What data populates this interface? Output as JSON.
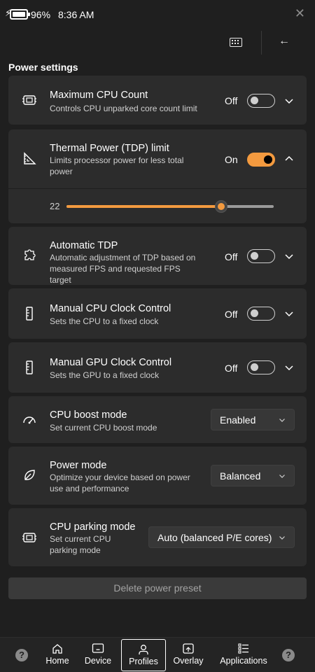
{
  "status_bar": {
    "battery_percent": "96%",
    "time": "8:36 AM",
    "close_label": "✕"
  },
  "header": {
    "back_label": "←"
  },
  "section_title": "Power settings",
  "settings": [
    {
      "title": "Maximum CPU Count",
      "desc": "Controls CPU unparked core count limit",
      "state": "Off",
      "on": false,
      "icon": "cpu-chip-icon"
    },
    {
      "title": "Thermal Power (TDP) limit",
      "desc": "Limits processor power for less total power",
      "state": "On",
      "on": true,
      "icon": "ruler-triangle-icon"
    },
    {
      "title": "Automatic TDP",
      "desc": "Automatic adjustment of TDP based on measured FPS and requested FPS target",
      "state": "Off",
      "on": false,
      "icon": "puzzle-icon"
    },
    {
      "title": "Manual CPU Clock Control",
      "desc": "Sets the CPU to a fixed clock",
      "state": "Off",
      "on": false,
      "icon": "ruler-icon"
    },
    {
      "title": "Manual GPU Clock Control",
      "desc": "Sets the GPU to a fixed clock",
      "state": "Off",
      "on": false,
      "icon": "ruler-icon"
    },
    {
      "title": "CPU boost mode",
      "desc": "Set current CPU boost mode",
      "select": "Enabled",
      "icon": "speedometer-icon"
    },
    {
      "title": "Power mode",
      "desc": "Optimize your device based on power use and performance",
      "select": "Balanced",
      "icon": "leaf-icon"
    },
    {
      "title": "CPU parking mode",
      "desc": "Set current CPU parking mode",
      "select": "Auto (balanced P/E cores)",
      "icon": "cpu-chip-icon"
    }
  ],
  "tdp_slider": {
    "value": "22",
    "fill_fraction": 0.745
  },
  "delete_button": "Delete power preset",
  "nav": {
    "items": [
      {
        "label": "Home",
        "icon": "home-icon"
      },
      {
        "label": "Device",
        "icon": "device-icon"
      },
      {
        "label": "Profiles",
        "icon": "person-icon",
        "active": true
      },
      {
        "label": "Overlay",
        "icon": "overlay-icon"
      },
      {
        "label": "Applications",
        "icon": "list-icon"
      }
    ],
    "help_label": "?"
  },
  "colors": {
    "accent": "#f39a3f",
    "card": "#2c2c2c",
    "background": "#1f1f1f"
  }
}
